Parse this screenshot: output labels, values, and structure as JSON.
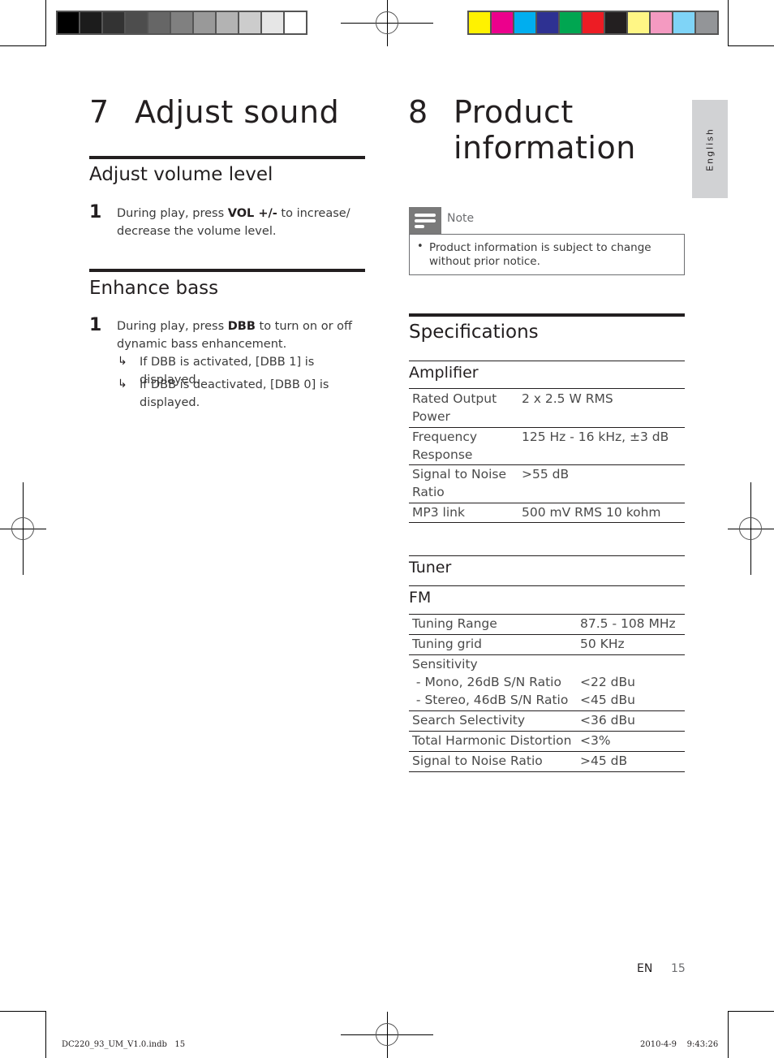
{
  "print_marks": {
    "grayscale_swatches": [
      "#000000",
      "#1c1c1c",
      "#333333",
      "#4d4d4d",
      "#666666",
      "#808080",
      "#999999",
      "#b3b3b3",
      "#cccccc",
      "#e6e6e6",
      "#ffffff"
    ],
    "color_swatches": [
      "#fff200",
      "#ec008c",
      "#00aeef",
      "#2e3192",
      "#00a651",
      "#ed1c24",
      "#231f20",
      "#fff685",
      "#f49ac1",
      "#7fd4f7",
      "#939598"
    ]
  },
  "left_column": {
    "chapter_number": "7",
    "chapter_title": "Adjust sound",
    "sections": [
      {
        "heading": "Adjust volume level",
        "steps": [
          {
            "num": "1",
            "pre": "During play, press ",
            "key": "VOL +/-",
            "post": " to increase/ decrease the volume level."
          }
        ]
      },
      {
        "heading": "Enhance bass",
        "steps": [
          {
            "num": "1",
            "pre": "During play, press ",
            "key": "DBB",
            "post": " to turn on or off dynamic bass enhancement.",
            "results": [
              "If DBB is activated, [DBB 1] is displayed.",
              "If DBB is deactivated, [DBB 0] is displayed."
            ]
          }
        ]
      }
    ]
  },
  "right_column": {
    "chapter_number": "8",
    "chapter_title_line1": "Product",
    "chapter_title_line2": "information",
    "note": {
      "label": "Note",
      "bullet": "•",
      "text": "Product information is subject to change without prior notice."
    },
    "specifications_heading": "Specifications",
    "amplifier": {
      "heading": "Amplifier",
      "rows": [
        {
          "label": "Rated Output Power",
          "value": "2 x 2.5 W RMS"
        },
        {
          "label": "Frequency Response",
          "value": "125 Hz - 16 kHz, ±3 dB"
        },
        {
          "label": "Signal to Noise Ratio",
          "value": ">55 dB"
        },
        {
          "label": "MP3 link",
          "value": "500 mV RMS 10 kohm"
        }
      ]
    },
    "tuner": {
      "heading": "Tuner",
      "band": "FM",
      "rows": [
        {
          "label": "Tuning Range",
          "value": "87.5 - 108 MHz"
        },
        {
          "label": "Tuning grid",
          "value": "50 KHz"
        },
        {
          "label": "Sensitivity",
          "value": ""
        },
        {
          "label": " - Mono, 26dB S/N Ratio",
          "value": "<22 dBu"
        },
        {
          "label": " - Stereo, 46dB S/N Ratio",
          "value": "<45 dBu"
        },
        {
          "label": "Search Selectivity",
          "value": "<36 dBu"
        },
        {
          "label": "Total Harmonic Distortion",
          "value": "<3%"
        },
        {
          "label": "Signal to Noise Ratio",
          "value": ">45 dB"
        }
      ]
    }
  },
  "side_tab": {
    "label": "English"
  },
  "footer": {
    "lang": "EN",
    "page": "15",
    "slug_file": "DC220_93_UM_V1.0.indb   15",
    "slug_date": "2010-4-9    9:43:26"
  }
}
